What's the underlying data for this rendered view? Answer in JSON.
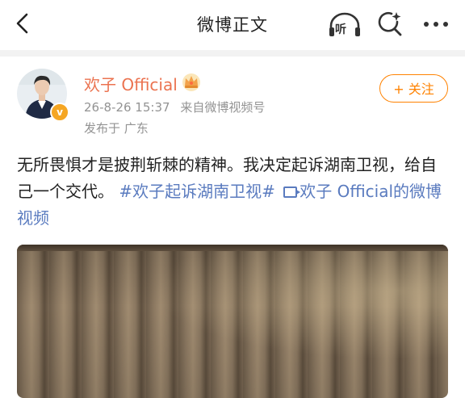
{
  "header": {
    "title": "微博正文",
    "listen_label": "听"
  },
  "post": {
    "username": "欢子 Official",
    "verified_badge": "v",
    "date": "26-8-26 15:37",
    "source": "来自微博视频号",
    "location": "发布于 广东",
    "follow_label": "+ 关注",
    "text_plain": "无所畏惧才是披荆斩棘的精神。我决定起诉湖南卫视，给自己一个交代。",
    "hashtag": "#欢子起诉湖南卫视#",
    "video_link_label": "欢子 Official的微博视频"
  },
  "colors": {
    "accent": "#ff8200",
    "username": "#eb7350",
    "link": "#5a7bbf"
  }
}
